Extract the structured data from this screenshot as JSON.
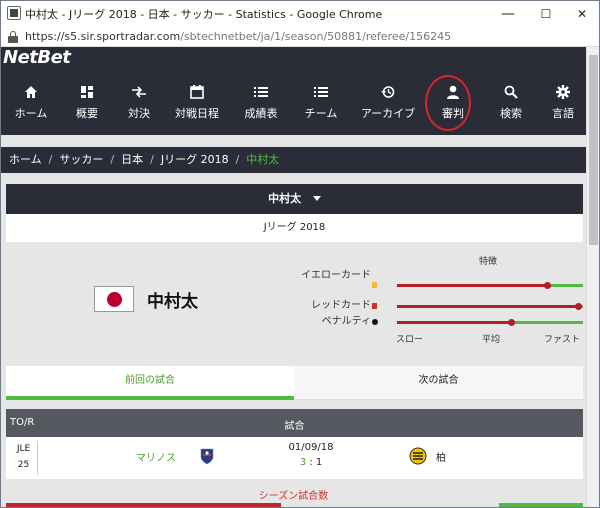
{
  "window": {
    "title": "中村太 - Jリーグ 2018 - 日本 - サッカー - Statistics - Google Chrome",
    "url_host": "https://s5.sir.sportradar.com",
    "url_path": "/sbtechnetbet/ja/1/season/50881/referee/156245",
    "minimize": "—",
    "maximize": "☐",
    "close": "✕"
  },
  "brand": {
    "logo": "NetBet"
  },
  "nav": [
    {
      "label": "ホーム",
      "icon": "home-icon"
    },
    {
      "label": "概要",
      "icon": "dashboard-icon"
    },
    {
      "label": "対決",
      "icon": "head-to-head-icon"
    },
    {
      "label": "対戦日程",
      "icon": "calendar-icon"
    },
    {
      "label": "成績表",
      "icon": "standings-icon"
    },
    {
      "label": "チーム",
      "icon": "teams-list-icon"
    },
    {
      "label": "アーカイブ",
      "icon": "history-icon"
    },
    {
      "label": "審判",
      "icon": "person-icon"
    },
    {
      "label": "検索",
      "icon": "search-icon"
    },
    {
      "label": "言語",
      "icon": "gear-icon"
    }
  ],
  "breadcrumb": [
    "ホーム",
    "サッカー",
    "日本",
    "Jリーグ 2018",
    "中村太"
  ],
  "referee": {
    "selector": "中村太",
    "season": "Jリーグ 2018",
    "name": "中村太",
    "country_flag": "Japan"
  },
  "stats": {
    "header": "特徴",
    "rows": [
      {
        "label": "イエローカード",
        "marker_color": "#f5b936",
        "level": 0.81
      },
      {
        "label": "レッドカード",
        "marker_color": "#d0312d",
        "level": 0.98
      },
      {
        "label": "ペナルティ",
        "marker_color": "#111111",
        "level": 0.62
      }
    ],
    "scale": [
      "スロー",
      "平均",
      "ファスト"
    ]
  },
  "tabs": {
    "previous": "前回の試合",
    "next": "次の試合"
  },
  "table": {
    "col_comp": "TO/R",
    "col_match": "試合",
    "rows": [
      {
        "comp": "JLE",
        "round": "25",
        "home": "マリノス",
        "date": "01/09/18",
        "home_score": "3",
        "score_sep": ":",
        "away_score": "1",
        "away": "柏"
      }
    ]
  },
  "section": {
    "season_matches": "シーズン試合数"
  },
  "colors": {
    "nav_bg": "#2a2d37",
    "accent_green": "#54b847",
    "accent_red": "#d0312d"
  }
}
